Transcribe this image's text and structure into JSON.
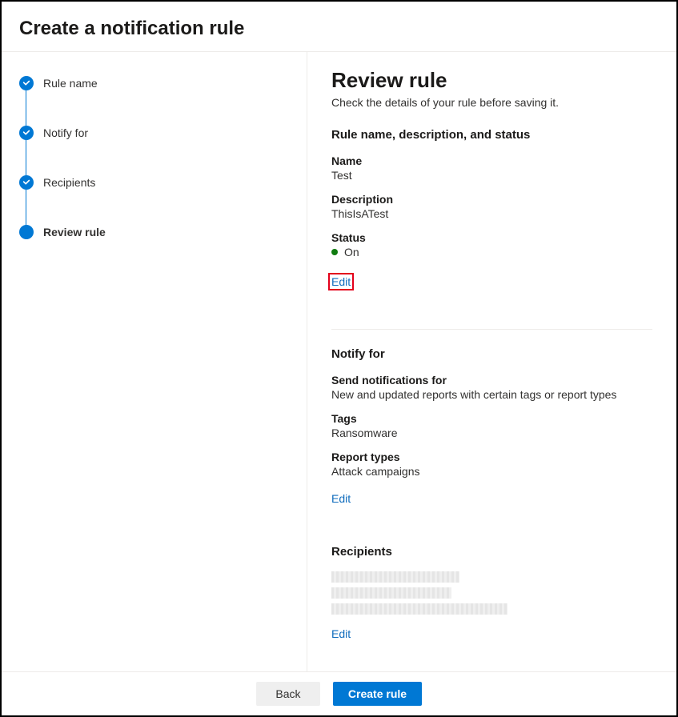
{
  "header": {
    "title": "Create a notification rule"
  },
  "sidebar": {
    "steps": [
      {
        "label": "Rule name",
        "state": "done"
      },
      {
        "label": "Notify for",
        "state": "done"
      },
      {
        "label": "Recipients",
        "state": "done"
      },
      {
        "label": "Review rule",
        "state": "current"
      }
    ]
  },
  "main": {
    "title": "Review rule",
    "subtitle": "Check the details of your rule before saving it.",
    "section1": {
      "heading": "Rule name, description, and status",
      "nameLabel": "Name",
      "nameValue": "Test",
      "descLabel": "Description",
      "descValue": "ThisIsATest",
      "statusLabel": "Status",
      "statusValue": "On",
      "statusColor": "#107c10",
      "editLabel": "Edit"
    },
    "section2": {
      "heading": "Notify for",
      "sendLabel": "Send notifications for",
      "sendValue": "New and updated reports with certain tags or report types",
      "tagsLabel": "Tags",
      "tagsValue": "Ransomware",
      "typesLabel": "Report types",
      "typesValue": "Attack campaigns",
      "editLabel": "Edit"
    },
    "section3": {
      "heading": "Recipients",
      "editLabel": "Edit"
    }
  },
  "footer": {
    "back": "Back",
    "create": "Create rule"
  },
  "colors": {
    "accent": "#0078d4",
    "link": "#0f6cbd",
    "highlight": "#e3001b"
  }
}
